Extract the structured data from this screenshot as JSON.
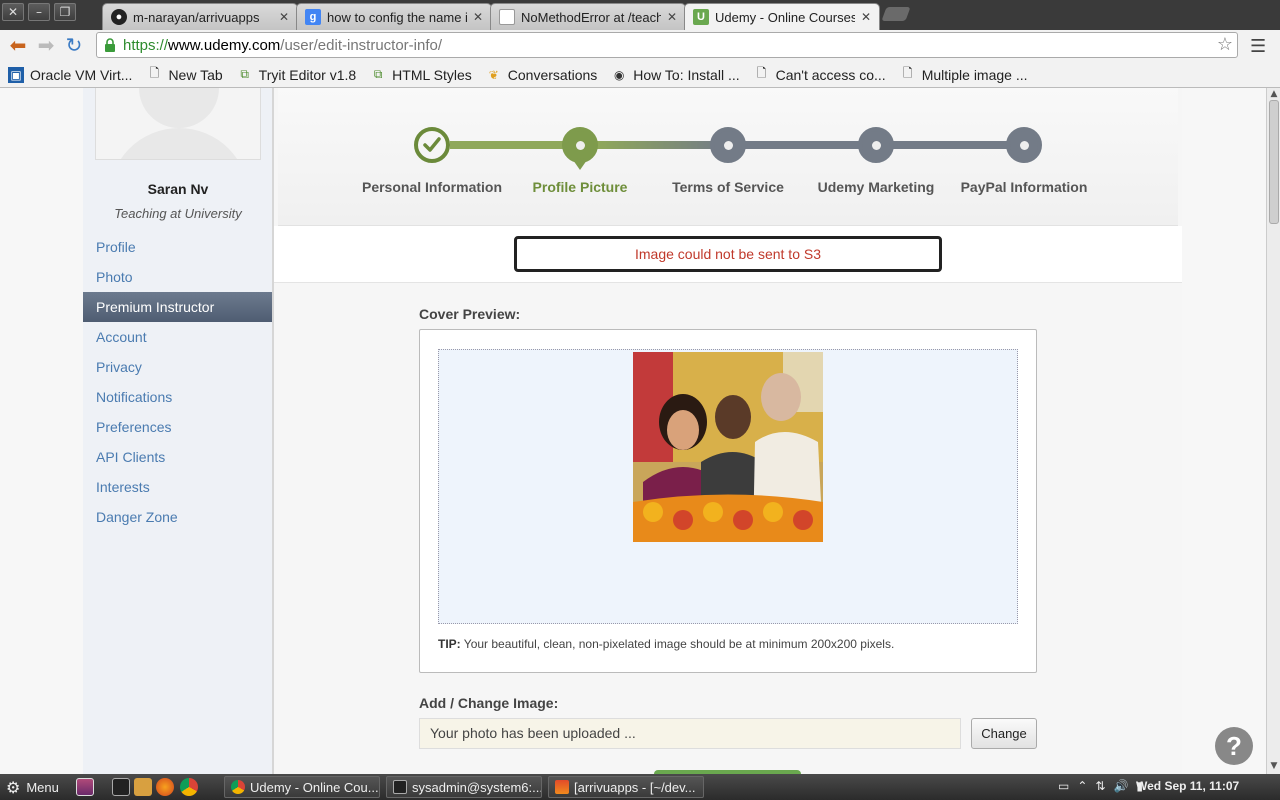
{
  "browser": {
    "tabs": [
      {
        "title": "m-narayan/arrivuapps",
        "icon": "github-icon",
        "color": "#222222"
      },
      {
        "title": "how to config the name in",
        "icon": "google-icon",
        "color": "#4285f4"
      },
      {
        "title": "NoMethodError at /teach",
        "icon": "page-icon",
        "color": "#ffffff"
      },
      {
        "title": "Udemy - Online Courses fr",
        "icon": "udemy-icon",
        "color": "#6aa84f"
      }
    ],
    "url": {
      "scheme": "https://",
      "host": "www.udemy.com",
      "path": "/user/edit-instructor-info/"
    },
    "bookmarks": [
      {
        "label": "Oracle VM Virt...",
        "icon": "virtualbox-icon"
      },
      {
        "label": "New Tab",
        "icon": "page-icon"
      },
      {
        "label": "Tryit Editor v1.8",
        "icon": "w3schools-icon"
      },
      {
        "label": "HTML Styles",
        "icon": "w3schools-icon"
      },
      {
        "label": "Conversations",
        "icon": "conversations-icon"
      },
      {
        "label": "How To: Install ...",
        "icon": "ubuntu-icon"
      },
      {
        "label": "Can't access co...",
        "icon": "page-icon"
      },
      {
        "label": "Multiple image ...",
        "icon": "page-icon"
      }
    ]
  },
  "user": {
    "name": "Saran Nv",
    "subtitle": "Teaching at University"
  },
  "sidebar": {
    "items": [
      {
        "label": "Profile"
      },
      {
        "label": "Photo"
      },
      {
        "label": "Premium Instructor"
      },
      {
        "label": "Account"
      },
      {
        "label": "Privacy"
      },
      {
        "label": "Notifications"
      },
      {
        "label": "Preferences"
      },
      {
        "label": "API Clients"
      },
      {
        "label": "Interests"
      },
      {
        "label": "Danger Zone"
      }
    ]
  },
  "steps": [
    {
      "label": "Personal Information",
      "state": "done"
    },
    {
      "label": "Profile Picture",
      "state": "current"
    },
    {
      "label": "Terms of Service",
      "state": "pending"
    },
    {
      "label": "Udemy Marketing",
      "state": "pending"
    },
    {
      "label": "PayPal Information",
      "state": "pending"
    }
  ],
  "alert": {
    "message": "Image could not be sent to S3"
  },
  "preview": {
    "label": "Cover Preview:",
    "tip_prefix": "TIP:",
    "tip_text": " Your beautiful, clean, non-pixelated image should be at minimum 200x200 pixels."
  },
  "upload": {
    "label": "Add / Change Image:",
    "status": "Your photo has been uploaded ...",
    "change_label": "Change"
  },
  "help": {
    "symbol": "?"
  },
  "taskbar": {
    "menu_label": "Menu",
    "tasks": [
      {
        "label": "Udemy - Online Cou..."
      },
      {
        "label": "sysadmin@system6:..."
      },
      {
        "label": "[arrivuapps - [~/dev..."
      }
    ],
    "clock": "Wed Sep 11, 11:07"
  },
  "colors": {
    "accent_green": "#7e9b4c",
    "link_blue": "#4a7bb0",
    "error_red": "#c0392b"
  }
}
